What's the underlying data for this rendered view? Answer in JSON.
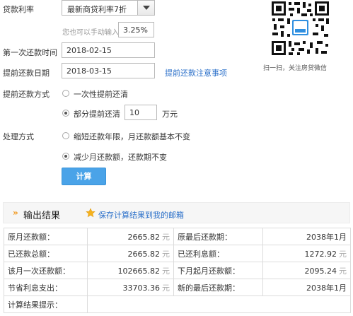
{
  "form": {
    "rate_label": "贷款利率",
    "rate_select_value": "最新商贷利率7折",
    "manual_hint": "您也可以手动输入",
    "rate_input_value": "3.25%",
    "first_payment_label": "第一次还款时间",
    "first_payment_value": "2018-02-15",
    "prepay_date_label": "提前还款日期",
    "prepay_date_value": "2018-03-15",
    "prepay_notice_link": "提前还款注意事项",
    "prepay_method_label": "提前还款方式",
    "option_full": "一次性提前还清",
    "option_partial": "部分提前还清",
    "partial_amount_value": "10",
    "partial_unit": "万元",
    "handling_label": "处理方式",
    "option_shorten": "缩短还款年限，月还款额基本不变",
    "option_reduce": "减少月还款额，还款期不变",
    "calc_button": "计算"
  },
  "qr": {
    "caption": "扫一扫，关注房贷微信",
    "center_text": "房贷计算器"
  },
  "result": {
    "title": "输出结果",
    "save_link": "保存计算结果到我的邮箱",
    "unit": "元",
    "rows": [
      {
        "l1": "原月还款额：",
        "v1": "2665.82",
        "l2": "原最后还款期：",
        "v2": "2038年1月"
      },
      {
        "l1": "已还款总额：",
        "v1": "2665.82",
        "l2": "已还利息额：",
        "v2": "1272.92"
      },
      {
        "l1": "该月一次还款额：",
        "v1": "102665.82",
        "l2": "下月起月还款额：",
        "v2": "2095.24"
      },
      {
        "l1": "节省利息支出：",
        "v1": "33703.36",
        "l2": "新的最后还款期：",
        "v2": "2038年1月"
      }
    ],
    "hint_label": "计算结果提示："
  },
  "colors": {
    "accent_blue": "#4aa3e8",
    "link_blue": "#2a6fc9",
    "result_arrow": "#f29a21"
  }
}
